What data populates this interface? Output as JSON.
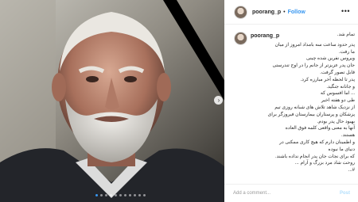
{
  "post": {
    "username": "poorang_p",
    "separator": "•",
    "follow_label": "Follow",
    "more_icon": "more-options-icon",
    "caption_lines": [
      "تمام شد.",
      "پدر حدود ساعت سه بامداد امروز از میان",
      "ما رفت.",
      "ویروس نفرین شده چینی",
      "جان پدر عزیزتر از جانم را در اوج تندرستی",
      "قابل تصور گرفت.",
      "پدر تا لحظه آخر مبارزه کرد.",
      "و جانانه جنگید.",
      "... اما افسوس که",
      "طی دو هفته اخیر",
      "از نزدیک شاهد تلاش های شبانه روزی تیم",
      "پزشکان و پرستاران بیمارستان فیروزگر برای",
      "بهبود حال پدر بودم.",
      "آنها به معنی واقعی کلمه فوق العاده",
      "هستند.",
      "و اطمینان دارم که هیچ کاری ممکنی در",
      "دنیای ما نبوده",
      "که برای نجات جان پدر انجام نداده باشند.",
      "روحت شاد مرد بزرگ و آرام ...",
      "#..."
    ],
    "comment_placeholder": "Add a comment...",
    "post_label": "Post",
    "carousel": {
      "count": 11,
      "active_index": 0
    }
  },
  "colors": {
    "accent": "#3897f0",
    "text": "#262626",
    "muted": "#999999"
  }
}
